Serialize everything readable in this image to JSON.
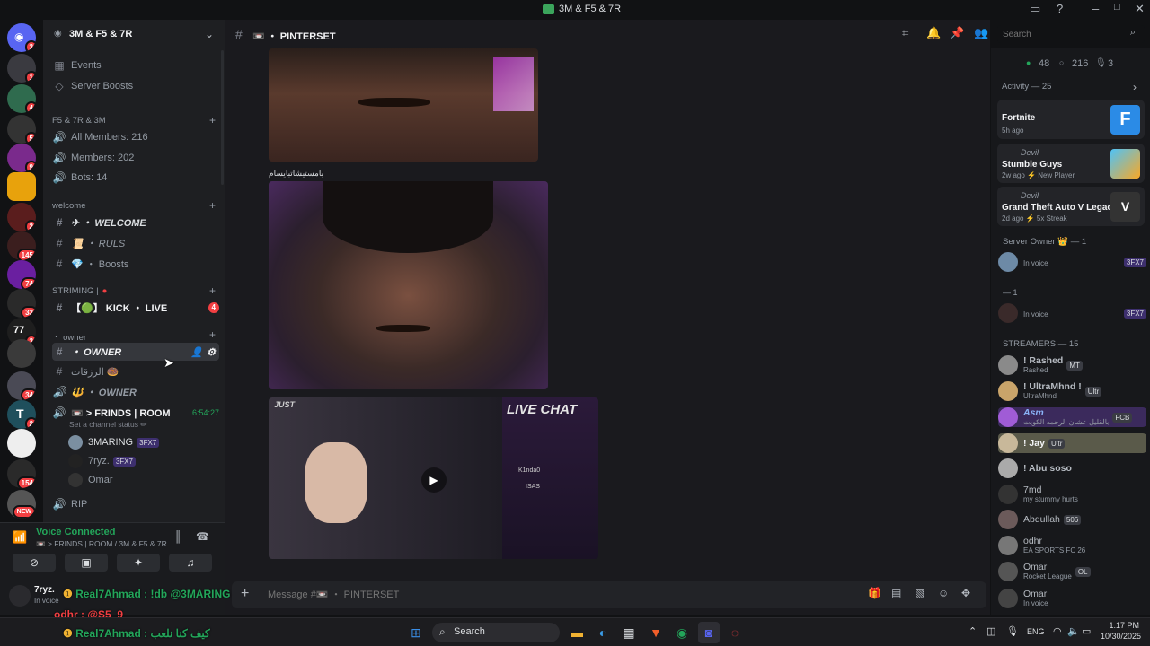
{
  "window": {
    "title": "3M & F5 & 7R"
  },
  "servers": [
    {
      "badge": "3"
    },
    {
      "badge": "1"
    },
    {
      "badge": "4"
    },
    {
      "badge": "5"
    },
    {
      "badge": "9"
    },
    {
      "badge": ""
    },
    {
      "badge": "2"
    },
    {
      "badge": "145"
    },
    {
      "badge": "74"
    },
    {
      "badge": "33"
    },
    {
      "badge": "3"
    },
    {
      "badge": ""
    },
    {
      "badge": "34"
    },
    {
      "badge": "2"
    },
    {
      "badge": ""
    },
    {
      "badge": "154"
    },
    {
      "badge": "NEW"
    }
  ],
  "server": {
    "name": "3M & F5 & 7R"
  },
  "sidebar": {
    "events": "Events",
    "boosts": "Server Boosts",
    "cat1": "F5 & 7R & 3M",
    "allmembers": "All Members: 216",
    "members": "Members: 202",
    "bots": "Bots: 14",
    "cat2": "welcome",
    "welcome": "✈ ・ WELCOME",
    "ruls": "📜 ・ RULS",
    "boostch": "💎 ・ Boosts",
    "cat3": "STRIMING |",
    "kick": "【🟢】 KICK ・ LIVE",
    "kick_badge": "4",
    "cat4": "・ owner",
    "owner": "・ OWNER",
    "ar": "الرزقات 🍩",
    "owner2": "🔱 ・ OWNER",
    "frinds": "📼 > FRINDS | ROOM",
    "frinds_time": "6:54:27",
    "status": "Set a channel status ✏",
    "vu1": "3MARING",
    "vu1_tag": "3FX7",
    "vu2": "7ryz.",
    "vu2_tag": "3FX7",
    "vu3": "Omar",
    "rip": "RIP"
  },
  "voice": {
    "title": "Voice Connected",
    "sub": "📼 > FRINDS | ROOM / 3M & F5 & 7R"
  },
  "user": {
    "name": "7ryz.",
    "status": "In voice"
  },
  "channel": {
    "name": "📼 ・ PINTERSET",
    "placeholder": "Message #📼 ・ PINTERSET"
  },
  "search": {
    "placeholder": "Search"
  },
  "messages": {
    "caption": "ﺑﺎﻣﺴﺘﻴﺸﺎﺗﺒﺎﻳﺴﺎﻡ",
    "just": "JUST",
    "livechat": "LIVE CHAT",
    "chat_user": "K1nda0",
    "chat_user2": "ISAS"
  },
  "overlay": {
    "l1": "Real7Ahmad : !db @3MARING",
    "l2": "odhr : @S5_9",
    "l3": "Real7Ahmad : كيف كنا نلعب"
  },
  "members": {
    "online": "48",
    "total": "216",
    "voice": "3",
    "activity": "Activity — 25",
    "acts": [
      {
        "user": "",
        "game": "Fortnite",
        "meta": "5h ago"
      },
      {
        "user": "Devil",
        "game": "Stumble Guys",
        "meta": "2w ago ⚡ New Player"
      },
      {
        "user": "Devil",
        "game": "Grand Theft Auto V Legacy",
        "meta": "2d ago ⚡ 5x Streak"
      }
    ],
    "owner_cat": "Server Owner 👑 — 1",
    "owner1": {
      "status": "In voice",
      "tag": "3FX7"
    },
    "booster_cat": "— 1",
    "booster1": {
      "status": "In voice",
      "tag": "3FX7"
    },
    "streamers_cat": "STREAMERS — 15",
    "list": [
      {
        "name": "! Rashed",
        "sub": "Rashed",
        "tag": "MT"
      },
      {
        "name": "! UltraMhnd !",
        "sub": "UltraMhnd",
        "tag": "Ultr"
      },
      {
        "name": "Asm",
        "sub": "بالقليل عشان الرحمه الكويت",
        "tag": "FCB"
      },
      {
        "name": "! Jay",
        "sub": "",
        "tag": "Ultr"
      },
      {
        "name": "! Abu soso",
        "sub": "",
        "tag": ""
      },
      {
        "name": "7md",
        "sub": "my stummy hurts",
        "tag": ""
      },
      {
        "name": "Abdullah",
        "sub": "",
        "tag": "506"
      },
      {
        "name": "odhr",
        "sub": "EA SPORTS FC 26",
        "tag": ""
      },
      {
        "name": "Omar",
        "sub": "Rocket League",
        "tag": "OL"
      },
      {
        "name": "Omar",
        "sub": "In voice",
        "tag": ""
      }
    ]
  },
  "taskbar": {
    "search": "Search",
    "lang": "ENG",
    "time": "1:17 PM",
    "date": "10/30/2025"
  },
  "colors": {
    "accent": "#5865f2",
    "online": "#23a55a",
    "danger": "#f23f42",
    "purple": "#8a2be2"
  }
}
